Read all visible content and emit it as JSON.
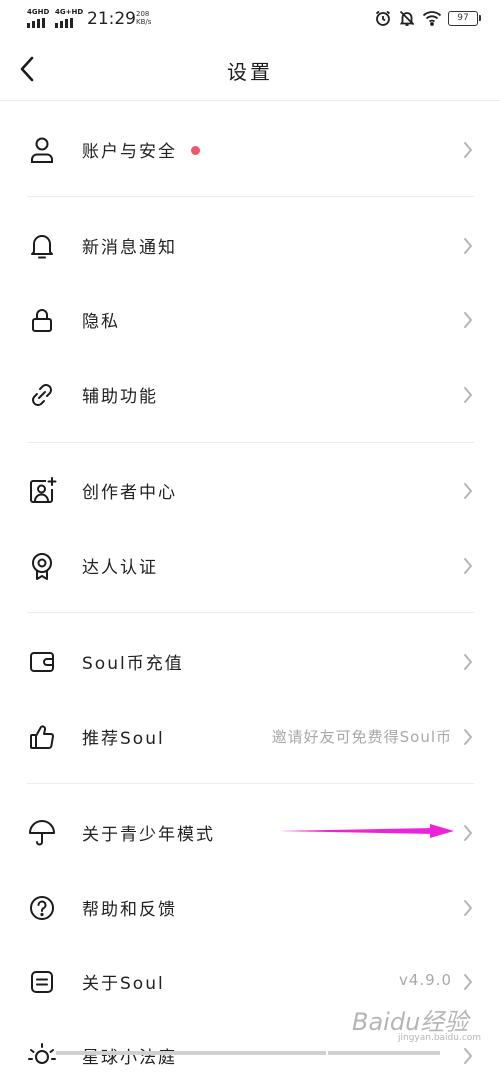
{
  "status_bar": {
    "signal1": "4GHD",
    "signal2": "4G+HD",
    "time": "21:29",
    "speed_value": "208",
    "speed_unit": "KB/s",
    "battery": "97",
    "icons": [
      "alarm-icon",
      "bell-off-icon",
      "wifi-icon",
      "battery-icon"
    ]
  },
  "header": {
    "title": "设置",
    "back_icon": "chevron-left-icon"
  },
  "settings": {
    "account": {
      "label": "账户与安全",
      "icon": "user-icon",
      "badge_color": "#f2556a"
    },
    "notifications": {
      "label": "新消息通知",
      "icon": "bell-icon"
    },
    "privacy": {
      "label": "隐私",
      "icon": "lock-icon"
    },
    "accessibility": {
      "label": "辅助功能",
      "icon": "link-icon"
    },
    "creator": {
      "label": "创作者中心",
      "icon": "portrait-plus-icon"
    },
    "verification": {
      "label": "达人认证",
      "icon": "badge-ribbon-icon"
    },
    "recharge": {
      "label": "Soul币充值",
      "icon": "wallet-icon"
    },
    "recommend": {
      "label": "推荐Soul",
      "sub": "邀请好友可免费得Soul币",
      "icon": "thumbs-up-icon"
    },
    "youth": {
      "label": "关于青少年模式",
      "icon": "umbrella-icon"
    },
    "help": {
      "label": "帮助和反馈",
      "icon": "question-circle-icon"
    },
    "about": {
      "label": "关于Soul",
      "sub": "v4.9.0",
      "icon": "document-icon"
    },
    "rules": {
      "label": "星球小法庭",
      "icon": "sun-icon"
    }
  },
  "annotation": {
    "arrow_color": "#ee22dd"
  },
  "watermark": {
    "text": "Baidu经验",
    "url": "jingyan.baidu.com"
  }
}
